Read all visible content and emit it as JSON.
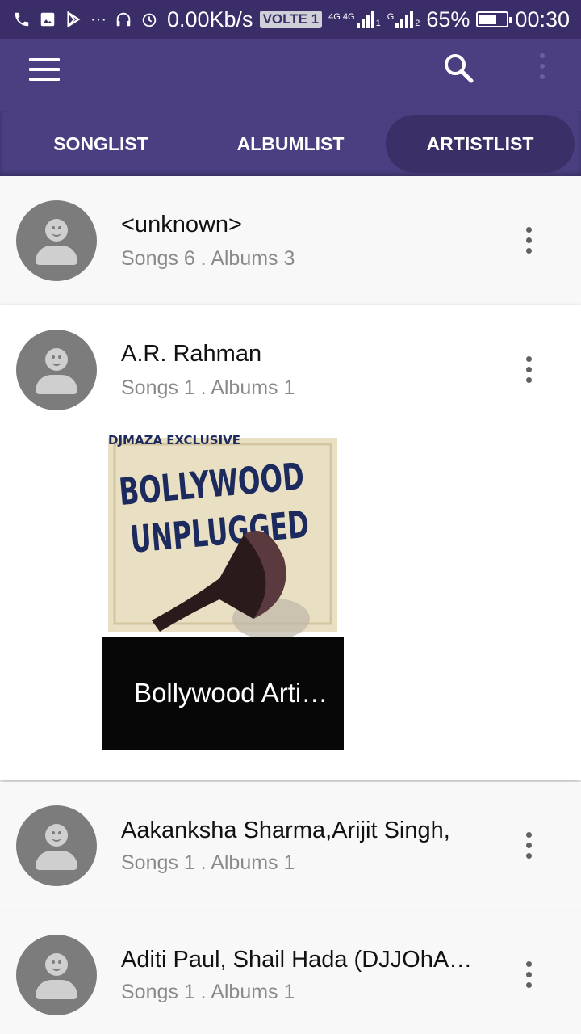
{
  "status_bar": {
    "network_speed": "0.00Kb/s",
    "volte": "VOLTE 1",
    "sim1_label": "4G 4G",
    "sim1_index": "1",
    "sim2_label": "G",
    "sim2_index": "2",
    "battery": "65%",
    "battery_level": 0.65,
    "time": "00:30",
    "left_icons": [
      "phone-icon",
      "image-icon",
      "play-store-icon",
      "more-notifications-icon",
      "headphones-icon",
      "alarm-icon"
    ]
  },
  "app_bar": {
    "icons": [
      "hamburger-menu-icon",
      "search-icon",
      "overflow-menu-icon"
    ]
  },
  "tabs": [
    {
      "label": "SONGLIST",
      "active": false
    },
    {
      "label": "ALBUMLIST",
      "active": false
    },
    {
      "label": "ARTISTLIST",
      "active": true
    }
  ],
  "artists": [
    {
      "name": "<unknown>",
      "meta": "Songs 6 . Albums 3"
    },
    {
      "name": "A.R. Rahman",
      "meta": "Songs 1 . Albums 1",
      "expanded": true,
      "albums": [
        {
          "title": "Bollywood Arti…",
          "cover_lines": [
            "DJMAZA EXCLUSIVE",
            "BOLLYWOOD",
            "UNPLUGGED"
          ]
        }
      ]
    },
    {
      "name": "Aakanksha Sharma,Arijit Singh,",
      "meta": "Songs 1 . Albums 1"
    },
    {
      "name": "Aditi Paul, Shail Hada (DJJOhA…",
      "meta": "Songs 1 . Albums 1"
    }
  ]
}
